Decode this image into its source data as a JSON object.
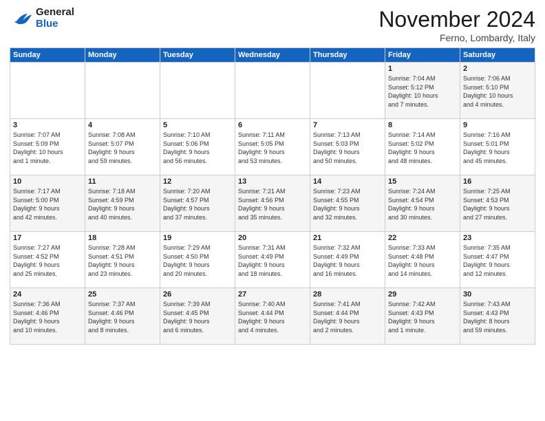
{
  "header": {
    "logo_general": "General",
    "logo_blue": "Blue",
    "month_title": "November 2024",
    "location": "Ferno, Lombardy, Italy"
  },
  "weekdays": [
    "Sunday",
    "Monday",
    "Tuesday",
    "Wednesday",
    "Thursday",
    "Friday",
    "Saturday"
  ],
  "weeks": [
    [
      {
        "day": "",
        "info": ""
      },
      {
        "day": "",
        "info": ""
      },
      {
        "day": "",
        "info": ""
      },
      {
        "day": "",
        "info": ""
      },
      {
        "day": "",
        "info": ""
      },
      {
        "day": "1",
        "info": "Sunrise: 7:04 AM\nSunset: 5:12 PM\nDaylight: 10 hours\nand 7 minutes."
      },
      {
        "day": "2",
        "info": "Sunrise: 7:06 AM\nSunset: 5:10 PM\nDaylight: 10 hours\nand 4 minutes."
      }
    ],
    [
      {
        "day": "3",
        "info": "Sunrise: 7:07 AM\nSunset: 5:09 PM\nDaylight: 10 hours\nand 1 minute."
      },
      {
        "day": "4",
        "info": "Sunrise: 7:08 AM\nSunset: 5:07 PM\nDaylight: 9 hours\nand 59 minutes."
      },
      {
        "day": "5",
        "info": "Sunrise: 7:10 AM\nSunset: 5:06 PM\nDaylight: 9 hours\nand 56 minutes."
      },
      {
        "day": "6",
        "info": "Sunrise: 7:11 AM\nSunset: 5:05 PM\nDaylight: 9 hours\nand 53 minutes."
      },
      {
        "day": "7",
        "info": "Sunrise: 7:13 AM\nSunset: 5:03 PM\nDaylight: 9 hours\nand 50 minutes."
      },
      {
        "day": "8",
        "info": "Sunrise: 7:14 AM\nSunset: 5:02 PM\nDaylight: 9 hours\nand 48 minutes."
      },
      {
        "day": "9",
        "info": "Sunrise: 7:16 AM\nSunset: 5:01 PM\nDaylight: 9 hours\nand 45 minutes."
      }
    ],
    [
      {
        "day": "10",
        "info": "Sunrise: 7:17 AM\nSunset: 5:00 PM\nDaylight: 9 hours\nand 42 minutes."
      },
      {
        "day": "11",
        "info": "Sunrise: 7:18 AM\nSunset: 4:59 PM\nDaylight: 9 hours\nand 40 minutes."
      },
      {
        "day": "12",
        "info": "Sunrise: 7:20 AM\nSunset: 4:57 PM\nDaylight: 9 hours\nand 37 minutes."
      },
      {
        "day": "13",
        "info": "Sunrise: 7:21 AM\nSunset: 4:56 PM\nDaylight: 9 hours\nand 35 minutes."
      },
      {
        "day": "14",
        "info": "Sunrise: 7:23 AM\nSunset: 4:55 PM\nDaylight: 9 hours\nand 32 minutes."
      },
      {
        "day": "15",
        "info": "Sunrise: 7:24 AM\nSunset: 4:54 PM\nDaylight: 9 hours\nand 30 minutes."
      },
      {
        "day": "16",
        "info": "Sunrise: 7:25 AM\nSunset: 4:53 PM\nDaylight: 9 hours\nand 27 minutes."
      }
    ],
    [
      {
        "day": "17",
        "info": "Sunrise: 7:27 AM\nSunset: 4:52 PM\nDaylight: 9 hours\nand 25 minutes."
      },
      {
        "day": "18",
        "info": "Sunrise: 7:28 AM\nSunset: 4:51 PM\nDaylight: 9 hours\nand 23 minutes."
      },
      {
        "day": "19",
        "info": "Sunrise: 7:29 AM\nSunset: 4:50 PM\nDaylight: 9 hours\nand 20 minutes."
      },
      {
        "day": "20",
        "info": "Sunrise: 7:31 AM\nSunset: 4:49 PM\nDaylight: 9 hours\nand 18 minutes."
      },
      {
        "day": "21",
        "info": "Sunrise: 7:32 AM\nSunset: 4:49 PM\nDaylight: 9 hours\nand 16 minutes."
      },
      {
        "day": "22",
        "info": "Sunrise: 7:33 AM\nSunset: 4:48 PM\nDaylight: 9 hours\nand 14 minutes."
      },
      {
        "day": "23",
        "info": "Sunrise: 7:35 AM\nSunset: 4:47 PM\nDaylight: 9 hours\nand 12 minutes."
      }
    ],
    [
      {
        "day": "24",
        "info": "Sunrise: 7:36 AM\nSunset: 4:46 PM\nDaylight: 9 hours\nand 10 minutes."
      },
      {
        "day": "25",
        "info": "Sunrise: 7:37 AM\nSunset: 4:46 PM\nDaylight: 9 hours\nand 8 minutes."
      },
      {
        "day": "26",
        "info": "Sunrise: 7:39 AM\nSunset: 4:45 PM\nDaylight: 9 hours\nand 6 minutes."
      },
      {
        "day": "27",
        "info": "Sunrise: 7:40 AM\nSunset: 4:44 PM\nDaylight: 9 hours\nand 4 minutes."
      },
      {
        "day": "28",
        "info": "Sunrise: 7:41 AM\nSunset: 4:44 PM\nDaylight: 9 hours\nand 2 minutes."
      },
      {
        "day": "29",
        "info": "Sunrise: 7:42 AM\nSunset: 4:43 PM\nDaylight: 9 hours\nand 1 minute."
      },
      {
        "day": "30",
        "info": "Sunrise: 7:43 AM\nSunset: 4:43 PM\nDaylight: 8 hours\nand 59 minutes."
      }
    ]
  ]
}
